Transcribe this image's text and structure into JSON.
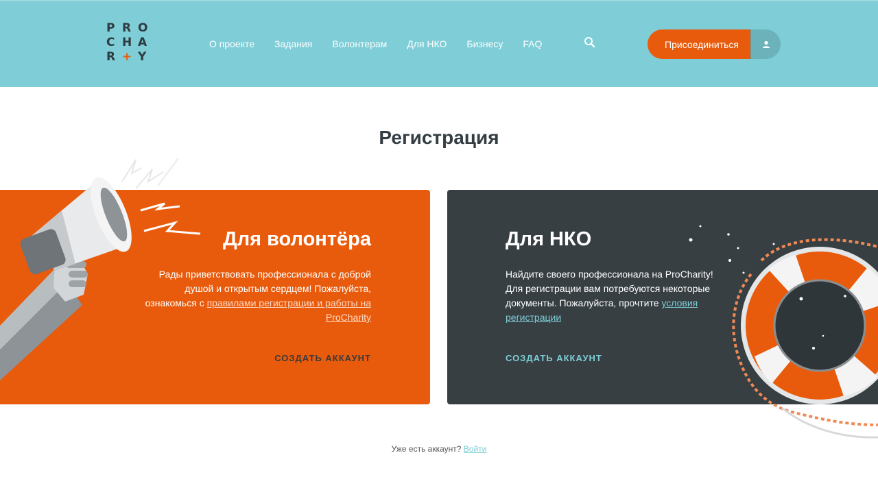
{
  "logo": {
    "row1": [
      "P",
      "R",
      "O"
    ],
    "row2": [
      "C",
      "H",
      "A"
    ],
    "row3": [
      "R",
      "+",
      "Y"
    ]
  },
  "nav": {
    "items": [
      {
        "label": "О проекте"
      },
      {
        "label": "Задания"
      },
      {
        "label": "Волонтерам"
      },
      {
        "label": "Для НКО"
      },
      {
        "label": "Бизнесу"
      },
      {
        "label": "FAQ"
      }
    ],
    "search_icon": "search-icon",
    "join_label": "Присоединиться",
    "user_icon": "user-icon"
  },
  "page": {
    "title": "Регистрация"
  },
  "volunteer_card": {
    "title": "Для волонтёра",
    "text_before_link": "Рады приветствовать профессионала с доброй душой и открытым сердцем! Пожалуйста, ознакомься с ",
    "link": "правилами регистрации и работы на ProCharity",
    "cta": "СОЗДАТЬ АККАУНТ",
    "bg_color": "#e95b0c",
    "illustration": "megaphone"
  },
  "nko_card": {
    "title": "Для НКО",
    "text_before_link": "Найдите своего профессионала на ProCharity! Для регистрации вам потребуются некоторые документы. Пожалуйста, прочтите ",
    "link": "условия регистрации",
    "cta": "СОЗДАТЬ АККАУНТ",
    "bg_color": "#373f43",
    "illustration": "lifebuoy"
  },
  "footer": {
    "question": "Уже есть аккаунт? ",
    "login_link": "Войти"
  },
  "colors": {
    "header": "#7ecdd7",
    "accent": "#e95b0c",
    "dark": "#373f43",
    "link": "#7ecdd7"
  }
}
